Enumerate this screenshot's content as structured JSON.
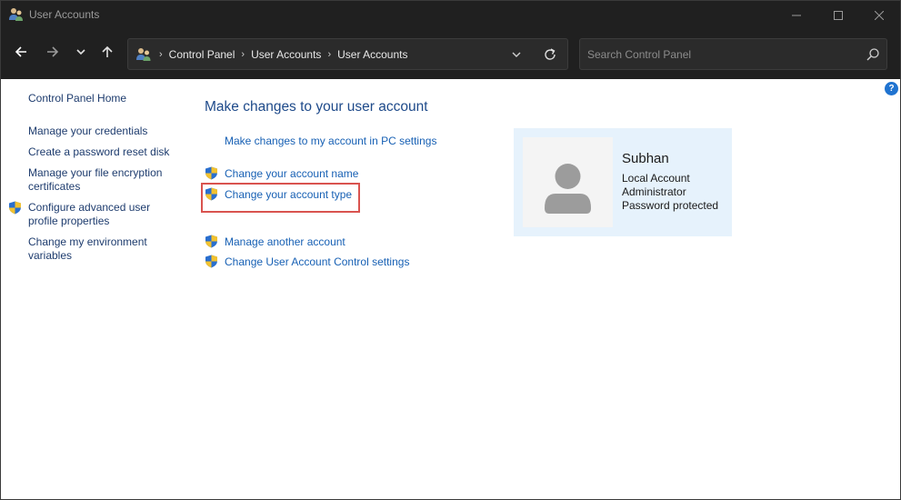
{
  "window": {
    "title": "User Accounts",
    "title_icon": "user-accounts-icon",
    "controls": [
      "minimize-icon",
      "maximize-icon",
      "close-icon"
    ]
  },
  "nav": {
    "back_icon": "back-arrow-icon",
    "forward_icon": "forward-arrow-icon",
    "recent_icon": "chevron-down-icon",
    "up_icon": "up-arrow-icon"
  },
  "address": {
    "crumbs": [
      "Control Panel",
      "User Accounts",
      "User Accounts"
    ]
  },
  "search": {
    "placeholder": "Search Control Panel"
  },
  "sidebar": {
    "home": "Control Panel Home",
    "items": [
      {
        "label": "Manage your credentials",
        "shield": false
      },
      {
        "label": "Create a password reset disk",
        "shield": false
      },
      {
        "label": "Manage your file encryption certificates",
        "shield": false
      },
      {
        "label": "Configure advanced user profile properties",
        "shield": true
      },
      {
        "label": "Change my environment variables",
        "shield": false
      }
    ]
  },
  "main": {
    "title": "Make changes to your user account",
    "pc_settings_link": "Make changes to my account in PC settings",
    "tasks": [
      {
        "label": "Change your account name",
        "shield": true
      },
      {
        "label": "Change your account type",
        "shield": true,
        "highlighted": true
      },
      {
        "label": "Manage another account",
        "shield": true
      },
      {
        "label": "Change User Account Control settings",
        "shield": true
      }
    ]
  },
  "user": {
    "name": "Subhan",
    "account_kind": "Local Account",
    "role": "Administrator",
    "password_status": "Password protected"
  },
  "colors": {
    "titlebar_bg": "#202020",
    "link": "#1760b4",
    "highlight_border": "#d9534f",
    "card_bg": "#e6f2fc"
  }
}
